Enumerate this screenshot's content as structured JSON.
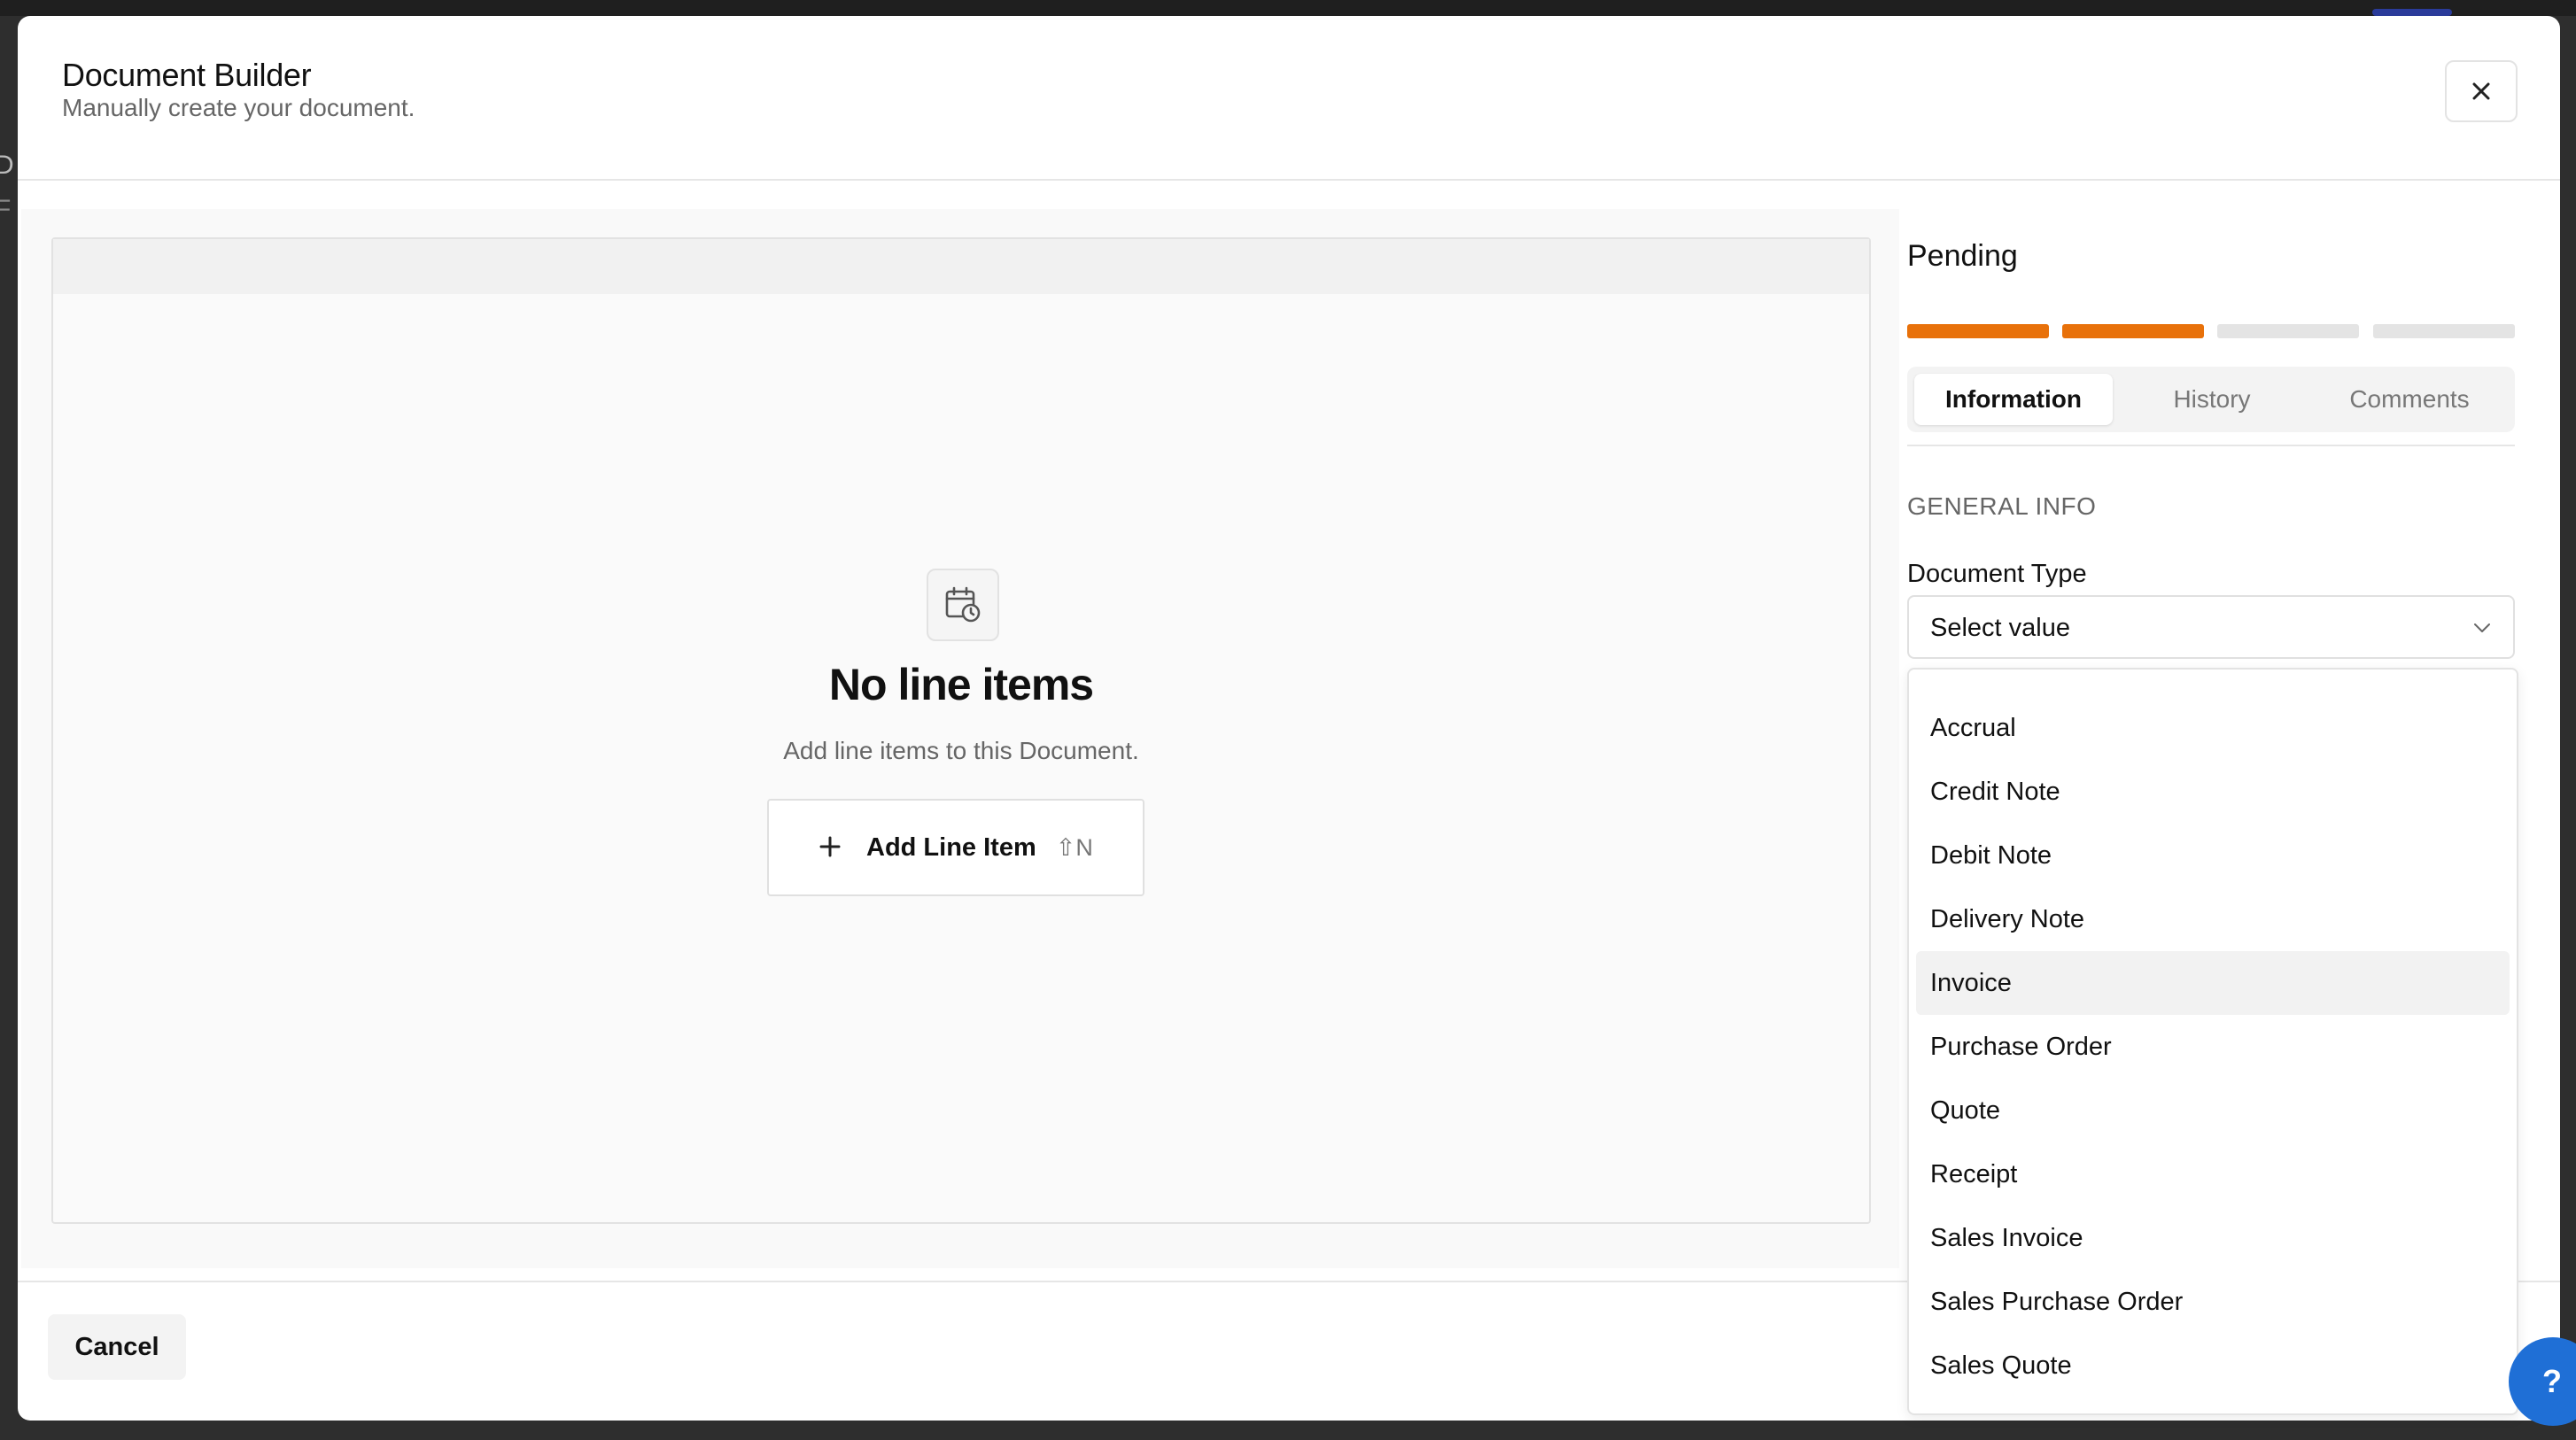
{
  "background_fragments": [
    "D",
    "F"
  ],
  "modal": {
    "title": "Document Builder",
    "subtitle": "Manually create your document.",
    "close_icon": "close-icon"
  },
  "empty_state": {
    "icon": "calendar-clock-icon",
    "title": "No line items",
    "subtitle": "Add line items to this Document.",
    "add_button_label": "Add Line Item",
    "add_button_shortcut": "⇧N"
  },
  "sidebar": {
    "status": "Pending",
    "progress": {
      "segments": 4,
      "completed": 2,
      "active_color": "#E8710A",
      "inactive_color": "#E4E4E4"
    },
    "tabs": [
      {
        "label": "Information",
        "active": true
      },
      {
        "label": "History",
        "active": false
      },
      {
        "label": "Comments",
        "active": false
      }
    ],
    "section_heading": "GENERAL INFO",
    "document_type": {
      "label": "Document Type",
      "value": "Select value",
      "options": [
        "Accrual",
        "Credit Note",
        "Debit Note",
        "Delivery Note",
        "Invoice",
        "Purchase Order",
        "Quote",
        "Receipt",
        "Sales Invoice",
        "Sales Purchase Order",
        "Sales Quote"
      ],
      "highlighted_option": "Invoice"
    }
  },
  "footer": {
    "cancel_label": "Cancel"
  },
  "help_button": {
    "label": "?",
    "color": "#1F6FD6"
  }
}
